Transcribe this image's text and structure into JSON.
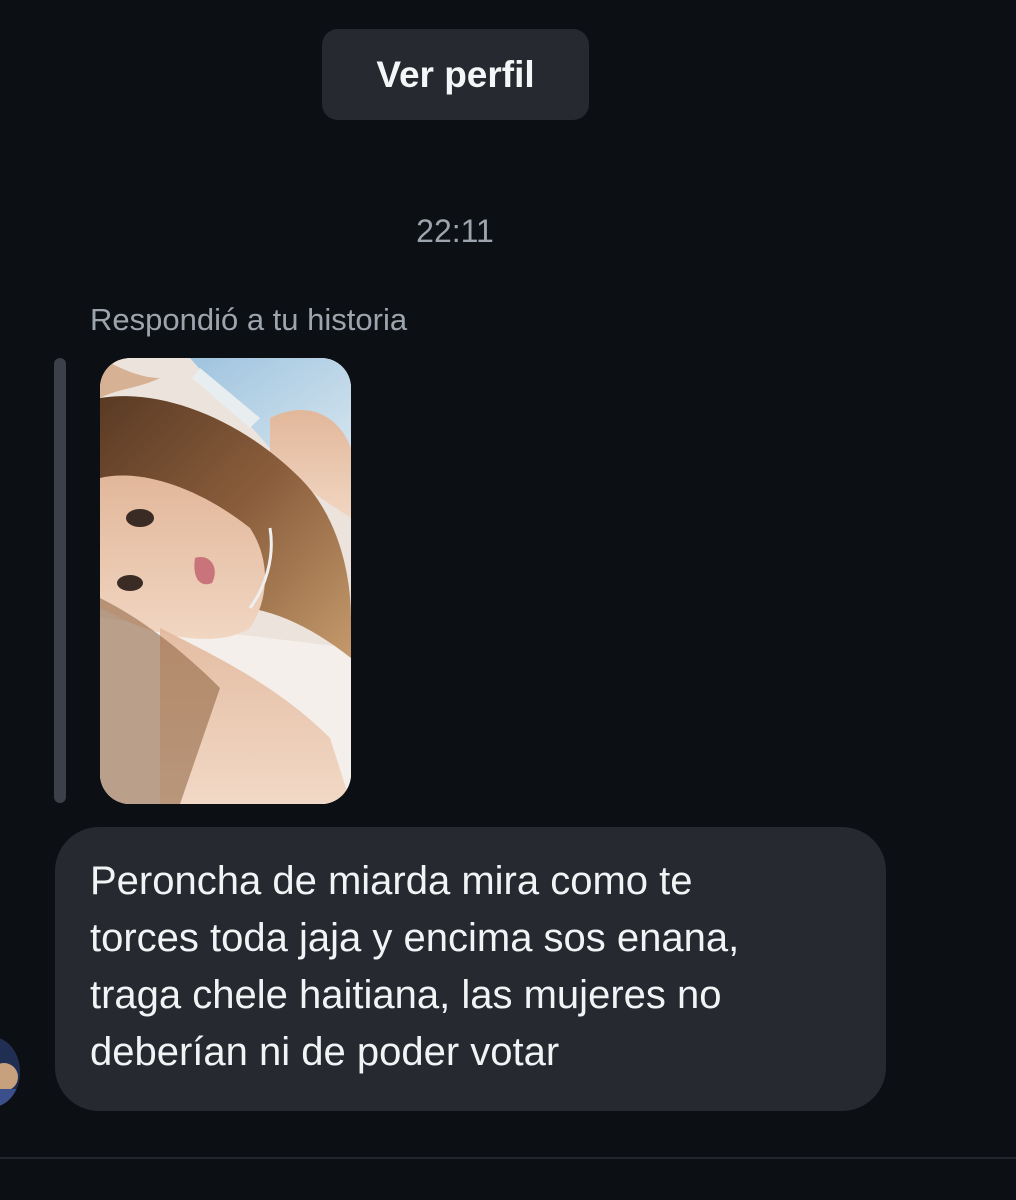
{
  "header": {
    "ver_perfil_label": "Ver perfil"
  },
  "conversation": {
    "timestamp": "22:11",
    "story_reply": {
      "label": "Respondió a tu historia"
    },
    "message": {
      "text": "Peroncha de miarda mira como te\ntorces toda jaja y encima sos enana,\ntraga chele haitiana, las mujeres no\ndeberían ni de poder votar"
    }
  },
  "colors": {
    "background": "#0c0f14",
    "bubble": "#262a30",
    "muted_text": "#9ea4ad",
    "quote_bar": "#3c4149"
  }
}
